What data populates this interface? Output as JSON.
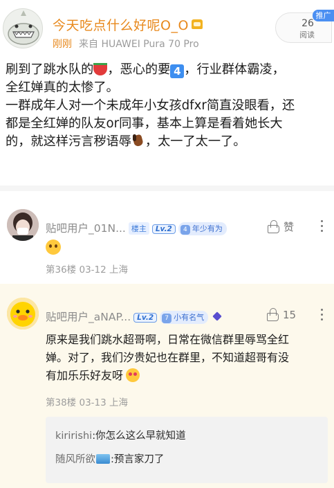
{
  "header": {
    "author": "今天吃点什么好呢O_O",
    "just_now": "刚刚",
    "device": "来自 HUAWEI Pura 70 Pro",
    "reads": "26",
    "reads_label": "阅读",
    "promo": "推广"
  },
  "post": {
    "line1a": "刷到了跳水队的",
    "line1b": "，恶心的要",
    "line1c": "，行业群体霸凌，",
    "line2": "全红婵真的太惨了。",
    "line3": "一群成年人对一个未成年小女孩dfxr简直没眼看，还",
    "line4": "都是全红婵的队友or同事，基本上算是看着她长大",
    "line5a": "的，就这样污言秽语辱",
    "line5b": "，太一了太一了。",
    "emoji_four": "4"
  },
  "comments": [
    {
      "user": "贴吧用户_01N...",
      "owner_tag": "楼主",
      "level": "Lv.2",
      "badge_num": "4",
      "badge": "年少有为",
      "like_label": "赞",
      "floor": "第36楼",
      "date": "03-12",
      "location": "上海"
    },
    {
      "user": "贴吧用户_aNAP...",
      "level": "Lv.2",
      "badge_num": "7",
      "badge": "小有名气",
      "likes": "15",
      "text_line1": "原来是我们跳水超哥啊，日常在微信群里辱骂全红",
      "text_line2": "婵。对了，我们汐贵妃也在群里，不知道超哥有没",
      "text_line3": "有加乐乐好友呀",
      "floor": "第38楼",
      "date": "03-13",
      "location": "上海",
      "replies": [
        {
          "user": "kiririshi",
          "text": ":你怎么这么早就知道"
        },
        {
          "user": "随风所欲",
          "text": ":预言家刀了"
        }
      ]
    }
  ]
}
